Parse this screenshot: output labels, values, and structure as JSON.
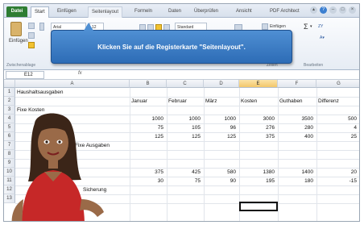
{
  "ribbon": {
    "tabs": [
      "Datei",
      "Start",
      "Einfügen",
      "Seitenlayout",
      "Formeln",
      "Daten",
      "Überprüfen",
      "Ansicht",
      "PDF Architect"
    ],
    "paste_label": "Einfügen",
    "clipboard_label": "Zwischenablage",
    "font_name": "Arial",
    "font_size": "12",
    "number_format": "Standard",
    "insert_label": "Einfügen",
    "cells_label": "Zellen",
    "editing_label": "Bearbeiten",
    "sigma": "Σ",
    "sum_arrow": "▾",
    "sort_label": "ZY"
  },
  "tooltip": {
    "text": "Klicken Sie auf die Registerkarte \"Seitenlayout\"."
  },
  "formula_bar": {
    "cell_ref": "E12",
    "fx": "fx"
  },
  "sheet": {
    "columns": [
      "A",
      "B",
      "C",
      "D",
      "E",
      "F",
      "G"
    ],
    "rows": [
      "1",
      "2",
      "3",
      "4",
      "5",
      "6",
      "7",
      "8",
      "9",
      "10",
      "11",
      "12",
      "13"
    ],
    "title": "Haushaltsausgaben",
    "headers": [
      "Januar",
      "Februar",
      "März",
      "Kosten",
      "Guthaben",
      "Differenz"
    ],
    "row3_label": "Fixe Kosten",
    "row4": [
      "1000",
      "1000",
      "1000",
      "3000",
      "3500",
      "500"
    ],
    "row5": [
      "75",
      "105",
      "96",
      "276",
      "280",
      "4"
    ],
    "row6": [
      "125",
      "125",
      "125",
      "375",
      "400",
      "25"
    ],
    "row7_label": "Fixe Ausgaben",
    "row10": [
      "375",
      "425",
      "580",
      "1380",
      "1400",
      "20"
    ],
    "row11": [
      "30",
      "75",
      "90",
      "195",
      "180",
      "-15"
    ],
    "row12_label": "Sicherung"
  }
}
